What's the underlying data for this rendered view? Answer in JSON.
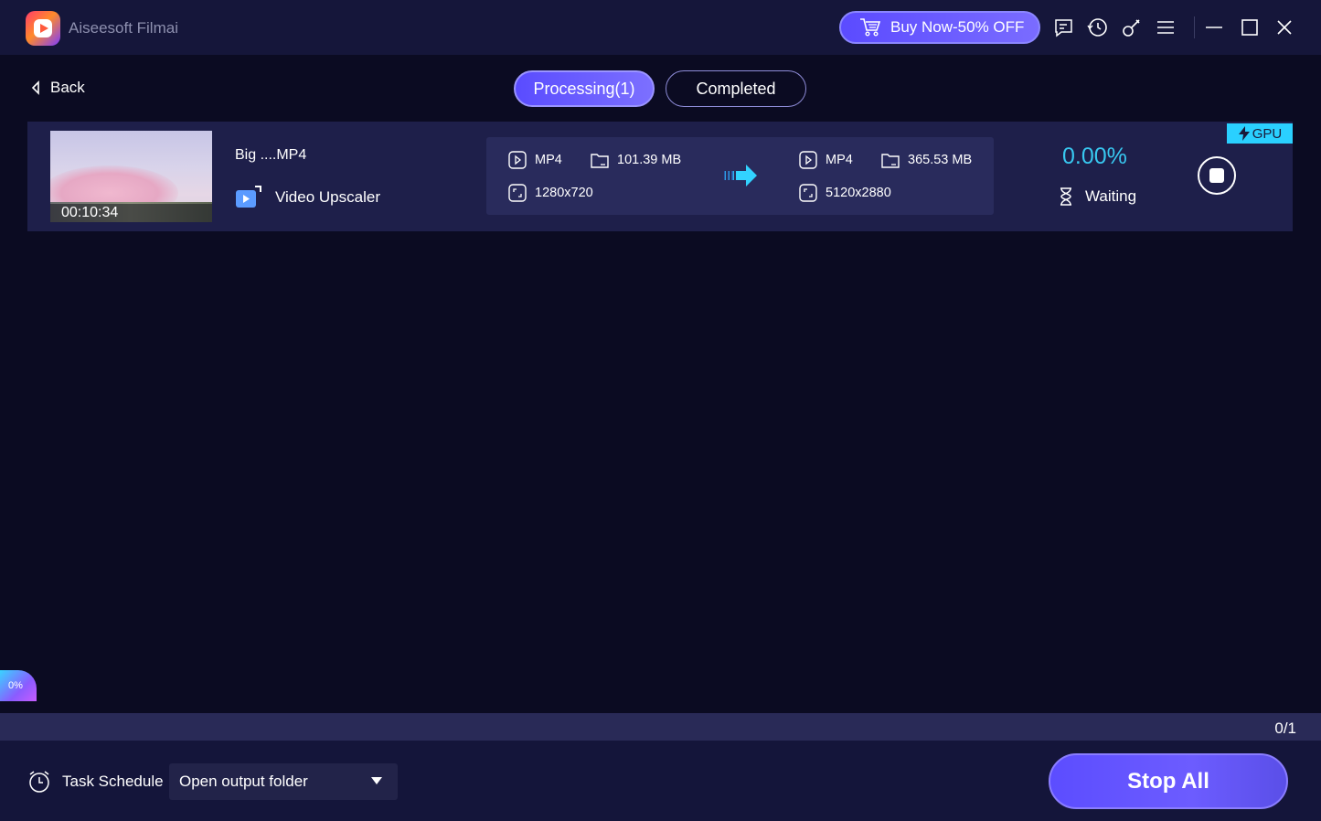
{
  "titlebar": {
    "app_title": "Aiseesoft Filmai",
    "buy_label": "Buy Now-50% OFF",
    "icons": [
      "cart-icon",
      "feedback-icon",
      "history-icon",
      "key-icon",
      "menu-icon",
      "minimize-icon",
      "maximize-icon",
      "close-icon"
    ]
  },
  "nav": {
    "back_label": "Back",
    "tabs": [
      {
        "label": "Processing(1)",
        "active": true
      },
      {
        "label": "Completed",
        "active": false
      }
    ]
  },
  "task": {
    "duration": "00:10:34",
    "file_name": "Big ....MP4",
    "tool": "Video Upscaler",
    "source": {
      "format": "MP4",
      "size": "101.39 MB",
      "resolution": "1280x720"
    },
    "output": {
      "format": "MP4",
      "size": "365.53 MB",
      "resolution": "5120x2880"
    },
    "progress": "0.00%",
    "status": "Waiting",
    "gpu_label": "GPU"
  },
  "side_badge": "0%",
  "count": "0/1",
  "footer": {
    "schedule_label": "Task Schedule",
    "after_action": "Open output folder",
    "stop_all_label": "Stop All"
  },
  "colors": {
    "background": "#0b0b22",
    "accent": "#5b4bff",
    "progress_text": "#38c8f0",
    "gpu_badge": "#2ad0ff"
  }
}
